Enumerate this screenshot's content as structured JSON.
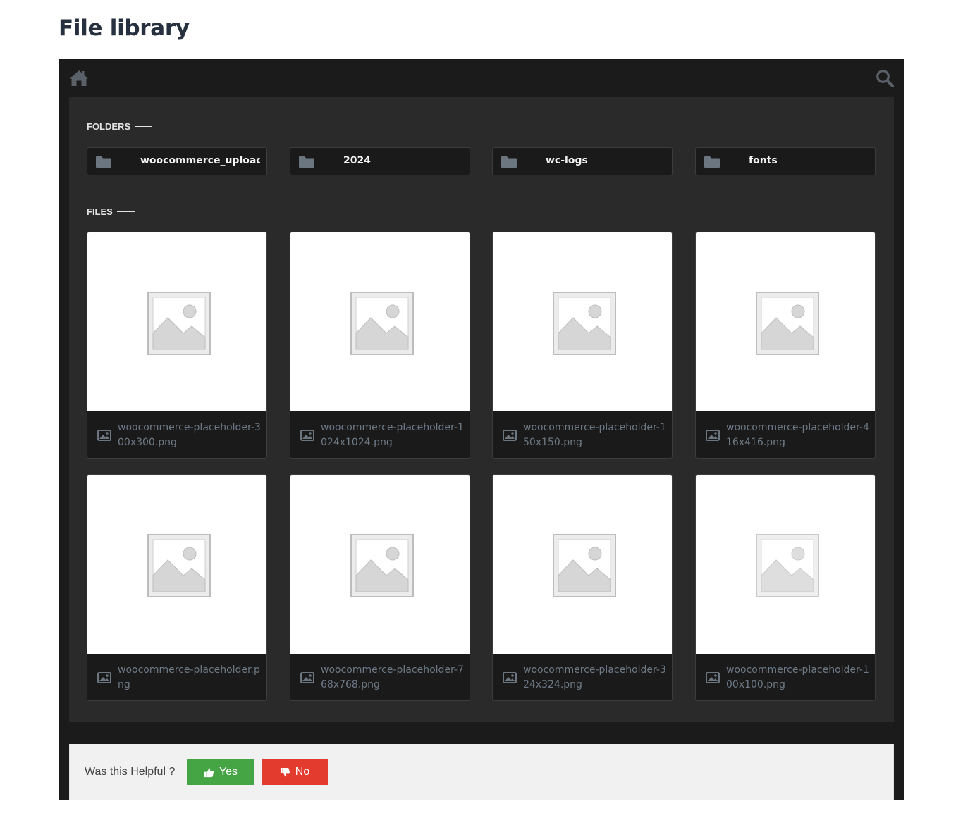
{
  "page": {
    "title": "File library"
  },
  "toolbar": {
    "home_icon": "home-icon",
    "search_icon": "search-icon",
    "icon_color": "#5a6169"
  },
  "folders": {
    "label": "FOLDERS",
    "items": [
      {
        "name": "woocommerce_uploads"
      },
      {
        "name": "2024"
      },
      {
        "name": "wc-logs"
      },
      {
        "name": "fonts"
      }
    ]
  },
  "files": {
    "label": "FILES",
    "items": [
      {
        "name": "woocommerce-placeholder-300x300.png"
      },
      {
        "name": "woocommerce-placeholder-1024x1024.png"
      },
      {
        "name": "woocommerce-placeholder-150x150.png"
      },
      {
        "name": "woocommerce-placeholder-416x416.png"
      },
      {
        "name": "woocommerce-placeholder.png"
      },
      {
        "name": "woocommerce-placeholder-768x768.png"
      },
      {
        "name": "woocommerce-placeholder-324x324.png"
      },
      {
        "name": "woocommerce-placeholder-100x100.png"
      }
    ]
  },
  "feedback": {
    "question": "Was this Helpful ?",
    "yes_label": "Yes",
    "no_label": "No",
    "yes_color": "#45a545",
    "no_color": "#e33b2e"
  }
}
